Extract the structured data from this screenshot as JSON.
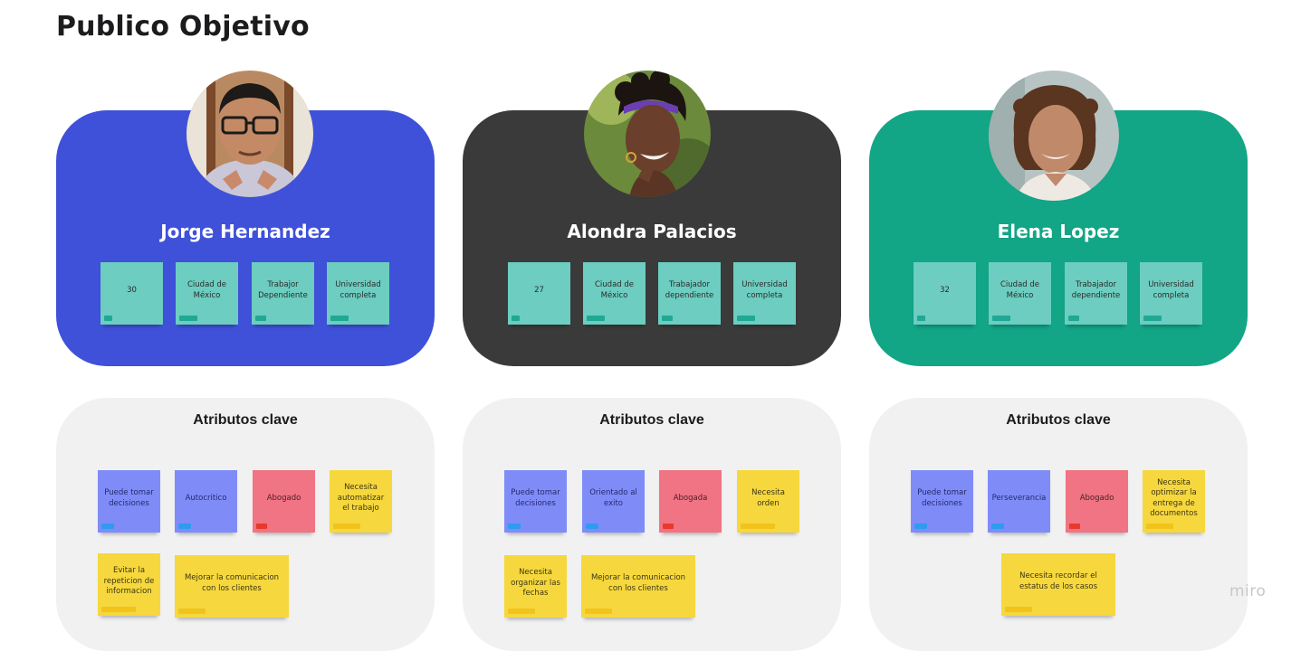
{
  "page": {
    "title": "Publico Objetivo"
  },
  "colors": {
    "persona_backgrounds": [
      "#3f51d9",
      "#3a3a3a",
      "#12a586"
    ],
    "sticky_teal": "#6ccdc0",
    "sticky_blue": "#7f8cf8",
    "sticky_red": "#f07483",
    "sticky_yellow": "#f6d83e",
    "attr_card": "#f1f1f1"
  },
  "personas": [
    {
      "name": "Jorge Hernandez",
      "avatar": "man-portrait",
      "facts": [
        "30",
        "Ciudad de México",
        "Trabajor Dependiente",
        "Universidad completa"
      ],
      "attributes_title": "Atributos clave",
      "attributes": [
        "Puede tomar decisiones",
        "Autocritico",
        "Abogado",
        "Necesita automatizar el trabajo",
        "Evitar la repeticion de informacion",
        "Mejorar la comunicacion con los clientes"
      ]
    },
    {
      "name": "Alondra Palacios",
      "avatar": "woman-portrait",
      "facts": [
        "27",
        "Ciudad de México",
        "Trabajador dependiente",
        "Universidad completa"
      ],
      "attributes_title": "Atributos clave",
      "attributes": [
        "Puede tomar decisiones",
        "Orientado al exito",
        "Abogada",
        "Necesita orden",
        "Necesita organizar las fechas",
        "Mejorar la comunicacion con los clientes"
      ]
    },
    {
      "name": "Elena Lopez",
      "avatar": "woman-portrait",
      "facts": [
        "32",
        "Ciudad de México",
        "Trabajador dependiente",
        "Universidad completa"
      ],
      "attributes_title": "Atributos clave",
      "attributes": [
        "Puede tomar decisiones",
        "Perseverancia",
        "Abogado",
        "Necesita optimizar la entrega de documentos",
        "Necesita recordar el estatus de los casos"
      ]
    }
  ],
  "brand": {
    "logo_text": "miro"
  }
}
